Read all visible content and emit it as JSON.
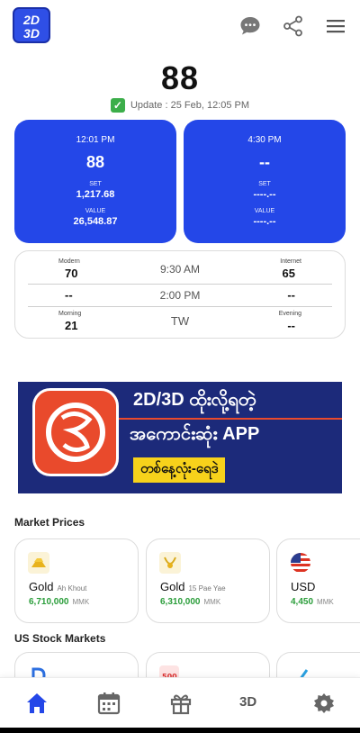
{
  "app": {
    "logo_line1": "2D",
    "logo_line2": "3D"
  },
  "header": {
    "result": "88",
    "update_text": "Update : 25 Feb, 12:05 PM"
  },
  "cards": [
    {
      "time": "12:01 PM",
      "number": "88",
      "set_label": "SET",
      "set_value": "1,217.68",
      "value_label": "VALUE",
      "value_value": "26,548.87"
    },
    {
      "time": "4:30 PM",
      "number": "--",
      "set_label": "SET",
      "set_value": "----.--",
      "value_label": "VALUE",
      "value_value": "----.--"
    }
  ],
  "schedule": {
    "row1": {
      "left_label": "Modern",
      "left_value": "70",
      "time": "9:30 AM",
      "right_label": "Internet",
      "right_value": "65"
    },
    "row2": {
      "left_value": "--",
      "time": "2:00 PM",
      "right_value": "--"
    },
    "row3": {
      "left_label": "Morning",
      "left_value": "21",
      "time": "TW",
      "right_label": "Evening",
      "right_value": "--"
    }
  },
  "banner": {
    "line1": "2D/3D ထိုးလို့ရတဲ့",
    "line2": "အကောင်းဆုံး APP",
    "tag": "တစ်နေ့လုံး-ရေဒဲ"
  },
  "market": {
    "title": "Market Prices",
    "items": [
      {
        "name": "Gold",
        "sub": "Ah Khout",
        "value": "6,710,000",
        "unit": "MMK",
        "icon": "gold-bar-icon"
      },
      {
        "name": "Gold",
        "sub": "15 Pae Yae",
        "value": "6,310,000",
        "unit": "MMK",
        "icon": "gold-ring-icon"
      },
      {
        "name": "USD",
        "sub": "",
        "value": "4,450",
        "unit": "MMK",
        "icon": "us-flag-icon"
      }
    ]
  },
  "stocks": {
    "title": "US Stock Markets",
    "items": [
      {
        "icon": "letter-d-icon"
      },
      {
        "icon": "sp500-icon"
      },
      {
        "icon": "chart-check-icon"
      }
    ]
  },
  "nav": {
    "third_label": "3D"
  },
  "colors": {
    "primary": "#2447e8",
    "success": "#2a9d3a",
    "check": "#3cae4a"
  }
}
